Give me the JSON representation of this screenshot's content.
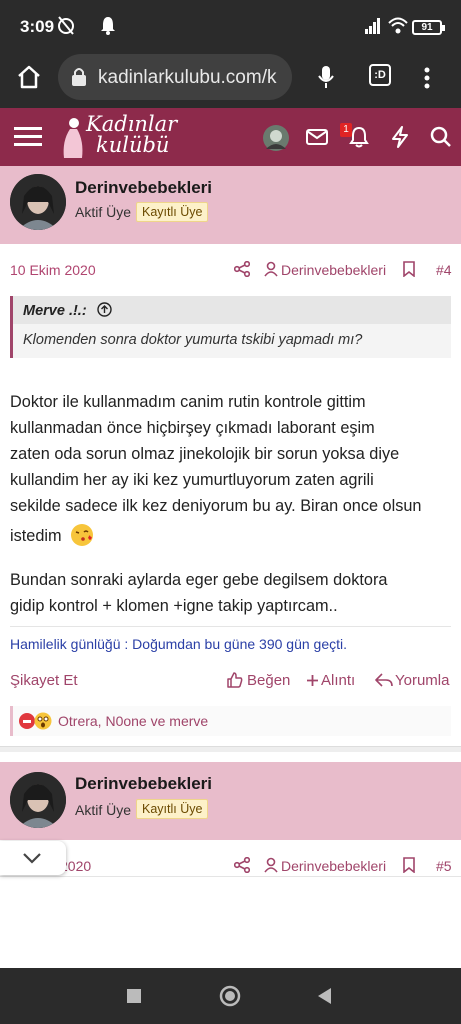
{
  "status": {
    "time": "3:09",
    "battery": "91"
  },
  "browser": {
    "url": "kadinlarkulubu.com/k",
    "tabs": ":D"
  },
  "site": {
    "logo_line1": "Kadınlar",
    "logo_line2": "kulübü",
    "notif_count": "1"
  },
  "post1": {
    "username": "Derinvebebekleri",
    "role": "Aktif Üye",
    "badge": "Kayıtlı Üye",
    "date": "10 Ekim 2020",
    "author_link": "Derinvebebekleri",
    "number": "#4",
    "quote_author": "Merve .!.:",
    "quote_text": "Klomenden sonra doktor yumurta tskibi yapmadı mı?",
    "para1_lines": [
      "Doktor ile kullanmadım canim rutin kontrole gittim",
      "kullanmadan önce hiçbirşey çıkmadı laborant eşim",
      "zaten oda sorun olmaz jinekolojik bir sorun yoksa diye",
      "kullandim her ay iki kez yumurtluyorum zaten agrili",
      "sekilde sadece ilk kez deniyorum bu ay. Biran once olsun",
      "istedim"
    ],
    "para2_lines": [
      "Bundan sonraki aylarda eger gebe degilsem doktora",
      "gidip kontrol + klomen +igne takip yaptırcam.."
    ],
    "signature": "Hamilelik günlüğü : Doğumdan bu güne 390 gün geçti.",
    "report": "Şikayet Et",
    "like": "Beğen",
    "quote_action": "Alıntı",
    "reply": "Yorumla",
    "reactions": "Otrera, N0one ve merve"
  },
  "post2": {
    "username": "Derinvebebekleri",
    "role": "Aktif Üye",
    "badge": "Kayıtlı Üye",
    "date_partial": "2020",
    "author_link": "Derinvebebekleri",
    "number": "#5"
  },
  "colors": {
    "brand": "#8d2a4b",
    "header_pink": "#e8bccb",
    "link": "#a0456a"
  },
  "icons": [
    "home-icon",
    "lock-icon",
    "mic-icon",
    "kebab-icon",
    "hamburger-icon",
    "mail-icon",
    "bell-icon",
    "bolt-icon",
    "search-icon",
    "share-icon",
    "user-icon",
    "bookmark-icon",
    "thumbs-up-icon",
    "plus-icon",
    "reply-icon",
    "chevron-down-icon"
  ]
}
